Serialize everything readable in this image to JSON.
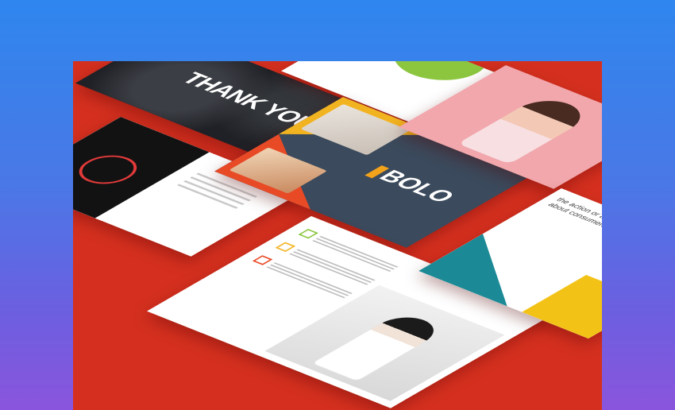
{
  "slides": {
    "thank_you": {
      "title": "THANK YOU"
    },
    "bolo": {
      "logo_text": "BOLO"
    },
    "quote": {
      "text": "the action or activity of gathering information about consumers' needs and preferences."
    }
  },
  "colors": {
    "panel_background": "#d5301f",
    "page_gradient_top": "#2f86ee",
    "page_gradient_bottom": "#8a55dc",
    "bolo_slide": "#3b4a5c",
    "accent_yellow": "#f2b321",
    "accent_orange": "#e84a26",
    "pink_slide": "#f1a7ac",
    "teal": "#1b8a96",
    "green": "#8cc63f"
  }
}
